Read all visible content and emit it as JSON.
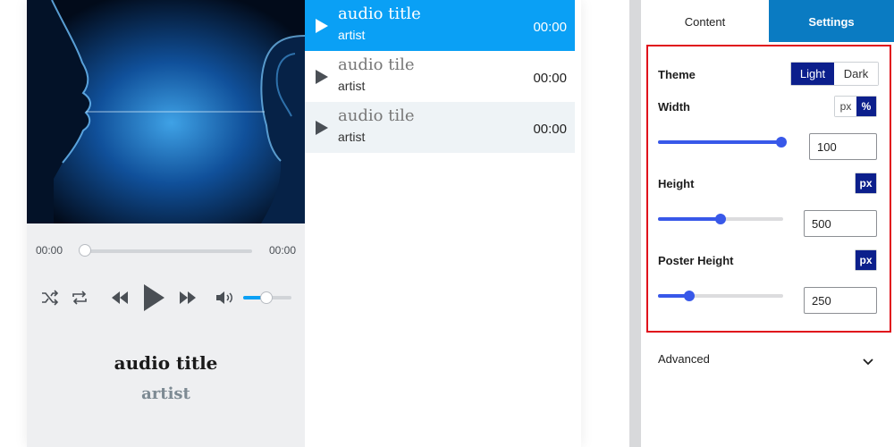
{
  "player": {
    "time_current": "00:00",
    "time_total": "00:00",
    "progress": 0,
    "volume": 0.5,
    "now_playing": {
      "title": "audio title",
      "artist": "artist"
    },
    "icons": [
      "shuffle-icon",
      "repeat-icon",
      "rewind-icon",
      "play-icon",
      "fast-forward-icon",
      "volume-icon"
    ]
  },
  "playlist": [
    {
      "title": "audio title",
      "artist": "artist",
      "duration": "00:00",
      "active": true
    },
    {
      "title": "audio tile",
      "artist": "artist",
      "duration": "00:00",
      "active": false
    },
    {
      "title": "audio tile",
      "artist": "artist",
      "duration": "00:00",
      "active": false
    }
  ],
  "panel": {
    "tabs": [
      {
        "label": "Content",
        "active": false
      },
      {
        "label": "Settings",
        "active": true
      }
    ],
    "theme": {
      "label": "Theme",
      "options": [
        "Light",
        "Dark"
      ],
      "selected": "Light"
    },
    "width": {
      "label": "Width",
      "units": [
        "px",
        "%"
      ],
      "unit": "%",
      "value": "100",
      "slider_fraction": 1.0
    },
    "height": {
      "label": "Height",
      "units": [
        "px"
      ],
      "unit": "px",
      "value": "500",
      "slider_fraction": 0.5
    },
    "poster_height": {
      "label": "Poster Height",
      "units": [
        "px"
      ],
      "unit": "px",
      "value": "250",
      "slider_fraction": 0.25
    },
    "advanced": {
      "label": "Advanced"
    }
  },
  "colors": {
    "accent": "#0aa0f5",
    "tab_active": "#0a7bc2",
    "toggle_active": "#0c1f8c",
    "slider": "#3858e9",
    "highlight_border": "#e0101b"
  }
}
